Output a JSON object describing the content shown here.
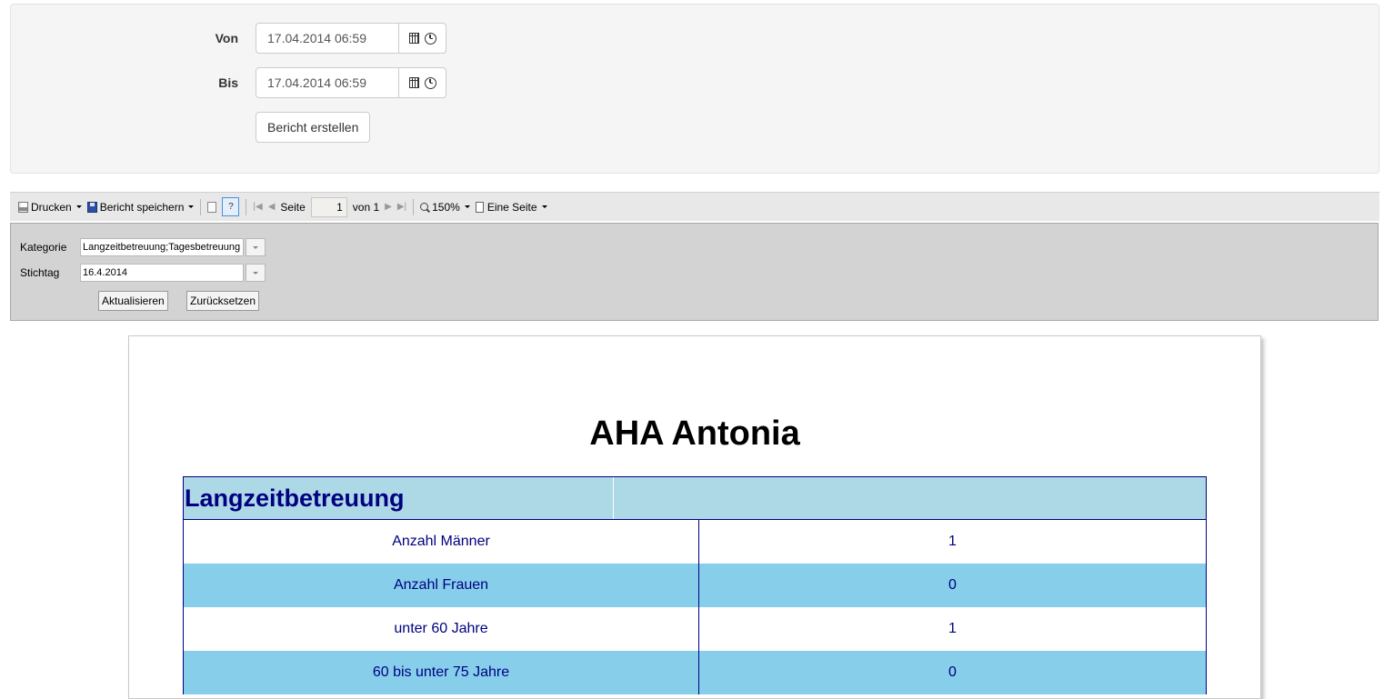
{
  "filter": {
    "from_label": "Von",
    "from_value": "17.04.2014 06:59",
    "to_label": "Bis",
    "to_value": "17.04.2014 06:59",
    "create_button": "Bericht erstellen"
  },
  "toolbar": {
    "print": "Drucken",
    "save": "Bericht speichern",
    "page_label": "Seite",
    "page_current": "1",
    "page_total": "von 1",
    "zoom": "150%",
    "view_mode": "Eine Seite"
  },
  "params": {
    "category_label": "Kategorie",
    "category_value": "Langzeitbetreuung;Tagesbetreuung",
    "date_label": "Stichtag",
    "date_value": "16.4.2014",
    "refresh_button": "Aktualisieren",
    "reset_button": "Zurücksetzen"
  },
  "report": {
    "title": "AHA Antonia",
    "section_title": "Langzeitbetreuung",
    "rows": [
      {
        "label": "Anzahl Männer",
        "value": "1"
      },
      {
        "label": "Anzahl Frauen",
        "value": "0"
      },
      {
        "label": "unter 60 Jahre",
        "value": "1"
      },
      {
        "label": "60 bis unter 75 Jahre",
        "value": "0"
      }
    ]
  }
}
